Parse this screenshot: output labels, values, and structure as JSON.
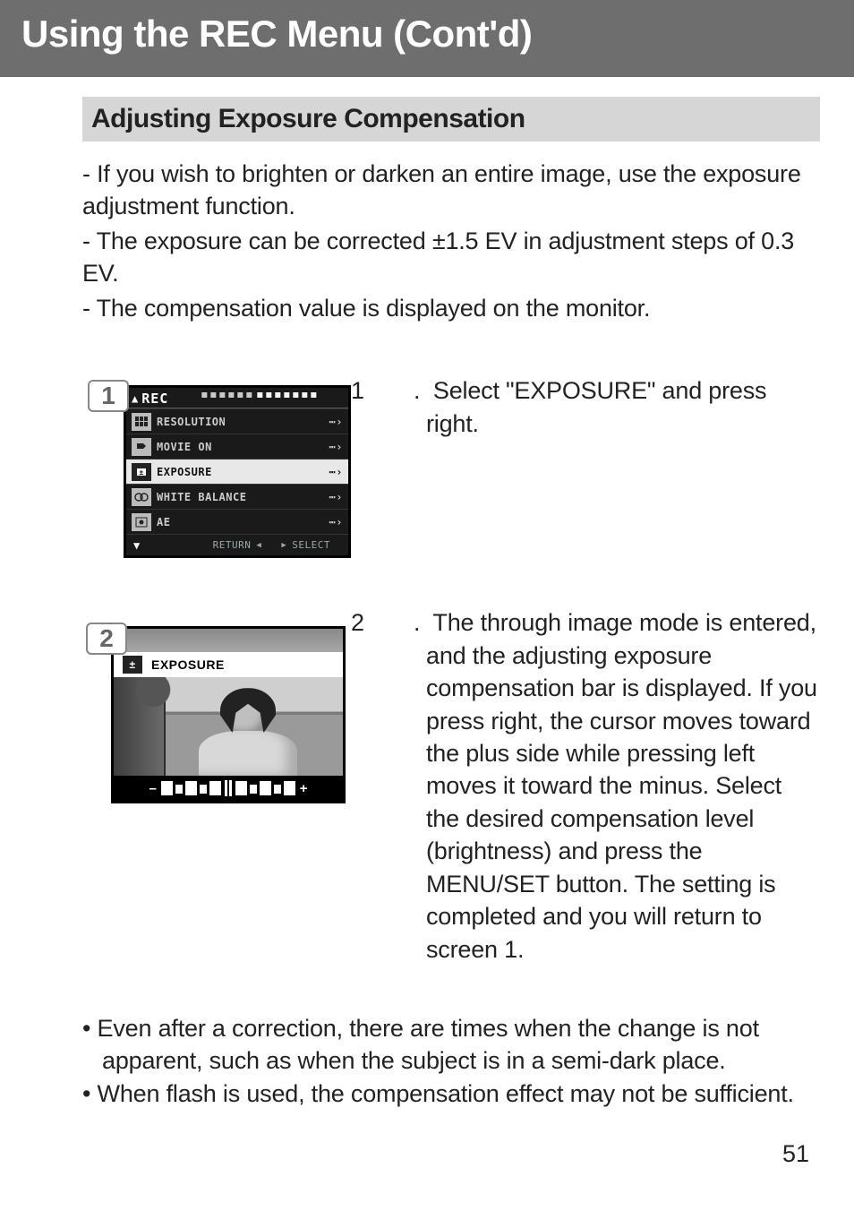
{
  "page_title": "Using the REC Menu (Cont'd)",
  "section_title": "Adjusting Exposure Compensation",
  "intro": [
    "- If you wish to brighten or darken an entire image, use the exposure adjustment function.",
    "- The exposure can be corrected ±1.5 EV in adjustment steps of 0.3 EV.",
    "- The compensation value is displayed on the monitor."
  ],
  "steps": [
    {
      "num": "1",
      "text": "Select \"EXPOSURE\" and press right."
    },
    {
      "num": "2",
      "text": "The through image mode is entered, and the adjusting exposure compensation bar is displayed. If you press right, the cursor moves toward the plus side while pressing left moves it toward the minus. Select the desired compensation level (brightness) and press the MENU/SET button. The setting is completed and you will return to screen 1."
    }
  ],
  "notes": [
    "• Even after a correction, there are times when the change is not apparent, such as when the subject is in a semi-dark place.",
    "• When flash is used, the compensation effect may not be sufficient."
  ],
  "page_number": "51",
  "fig1": {
    "badge": "1",
    "header": "REC",
    "menu": [
      "RESOLUTION",
      "MOVIE ON",
      "EXPOSURE",
      "WHITE BALANCE",
      "AE"
    ],
    "footer_left": "RETURN",
    "footer_right": "SELECT"
  },
  "fig2": {
    "badge": "2",
    "title": "EXPOSURE",
    "minus": "–",
    "plus": "+"
  }
}
